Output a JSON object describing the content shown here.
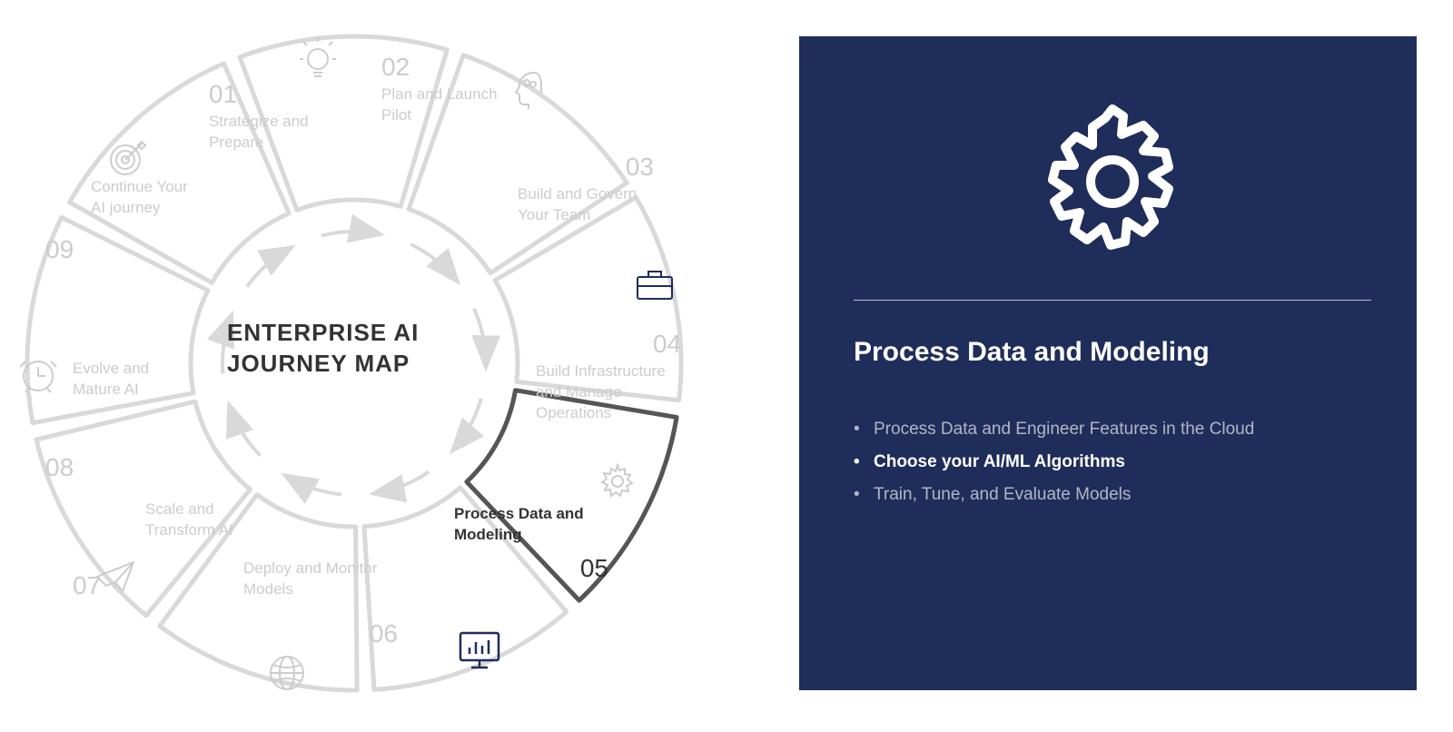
{
  "center_title": "ENTERPRISE AI JOURNEY MAP",
  "segments": [
    {
      "num": "01",
      "label": "Strategize and Prepare",
      "active": false,
      "icon": "lightbulb"
    },
    {
      "num": "02",
      "label": "Plan and Launch Pilot",
      "active": false,
      "icon": "head"
    },
    {
      "num": "03",
      "label": "Build and Govern Your Team",
      "active": false,
      "icon": "briefcase"
    },
    {
      "num": "04",
      "label": "Build Infrastructure and Manage Operations",
      "active": false,
      "icon": "gear-small"
    },
    {
      "num": "05",
      "label": "Process Data and Modeling",
      "active": true,
      "icon": "monitor-chart"
    },
    {
      "num": "06",
      "label": "Deploy and Monitor Models",
      "active": false,
      "icon": "globe"
    },
    {
      "num": "07",
      "label": "Scale and Transform AI",
      "active": false,
      "icon": "paper-plane"
    },
    {
      "num": "08",
      "label": "Evolve and Mature AI",
      "active": false,
      "icon": "clock"
    },
    {
      "num": "09",
      "label": "Continue Your AI journey",
      "active": false,
      "icon": "target"
    }
  ],
  "detail": {
    "title": "Process Data and Modeling",
    "icon": "gear-large",
    "bullets": [
      {
        "text": "Process Data and Engineer Features in the Cloud",
        "active": false
      },
      {
        "text": "Choose your AI/ML Algorithms",
        "active": true
      },
      {
        "text": "Train, Tune, and Evaluate Models",
        "active": false
      }
    ]
  }
}
